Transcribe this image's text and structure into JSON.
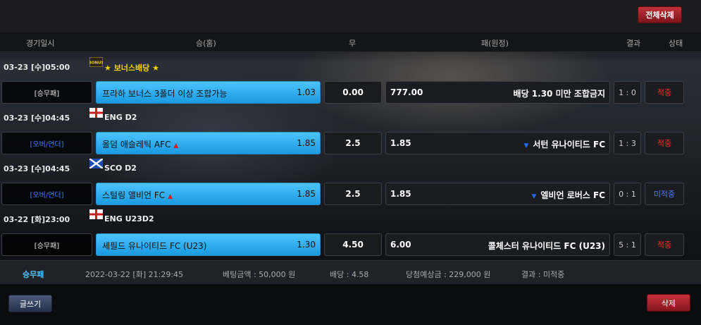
{
  "toolbar": {
    "delete_all": "전체삭제"
  },
  "header": {
    "date": "경기일시",
    "home": "승(홈)",
    "draw": "무",
    "away": "패(원정)",
    "result": "결과",
    "status": "상태"
  },
  "games": [
    {
      "date": "03-23 [수]05:00",
      "league": "★ 보너스배당 ★",
      "flag_icon": "bonus-badge-icon",
      "bet_type": "[승무패]",
      "home": "프라하 보너스 3폴더 이상 조합가능",
      "home_odds": "1.03",
      "draw": "0.00",
      "away_odds": "777.00",
      "away": "배당 1.30 미만 조합금지",
      "score": "1 : 0",
      "status": "적중"
    },
    {
      "date": "03-23 [수]04:45",
      "league": "ENG D2",
      "flag_icon": "england-flag-icon",
      "bet_type": "[오버/언더]",
      "home": "올덤 애슬레틱 AFC",
      "home_odds": "1.85",
      "draw": "2.5",
      "away_odds": "1.85",
      "away": "서턴 유나이티드 FC",
      "score": "1 : 3",
      "status": "적중"
    },
    {
      "date": "03-23 [수]04:45",
      "league": "SCO D2",
      "flag_icon": "scotland-flag-icon",
      "bet_type": "[오버/언더]",
      "home": "스털링 앨비언 FC",
      "home_odds": "1.85",
      "draw": "2.5",
      "away_odds": "1.85",
      "away": "엘비언 로버스 FC",
      "score": "0 : 1",
      "status": "미적중"
    },
    {
      "date": "03-22 [화]23:00",
      "league": "ENG U23D2",
      "flag_icon": "england-flag-icon",
      "bet_type": "[승무패]",
      "home": "셰필드 유나이티드 FC (U23)",
      "home_odds": "1.30",
      "draw": "4.50",
      "away_odds": "6.00",
      "away": "콜체스터 유나이티드 FC (U23)",
      "score": "5 : 1",
      "status": "적중"
    }
  ],
  "summary": {
    "kind": "승무패",
    "datetime": "2022-03-22 [화] 21:29:45",
    "bet_amount": "베팅금액 : 50,000 원",
    "odds": "배당 : 4.58",
    "expected": "당첨예상금 : 229,000 원",
    "result": "결과 : 미적중"
  },
  "footer": {
    "write": "글쓰기",
    "delete": "삭제"
  },
  "colors": {
    "home_cell": "#1a9ae0",
    "win_status": "#ff2b2b",
    "lose_status": "#4a7cff",
    "delete_button": "#c0323a"
  }
}
